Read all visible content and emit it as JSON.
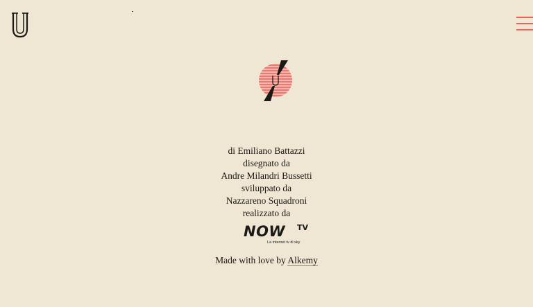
{
  "credits": {
    "line1": "di Emiliano Battazzi",
    "line2": "disegnato da",
    "line3": "Andre Milandri Bussetti",
    "line4": "sviluppato da",
    "line5": "Nazzareno Squadroni",
    "line6": "realizzato da"
  },
  "sponsor": {
    "brand": "NOW",
    "suffix": "TV",
    "tagline": "La internet tv di sky"
  },
  "footer": {
    "text": "Made with love by",
    "link_label": "Alkemy"
  },
  "colors": {
    "background": "#efe6d4",
    "accent": "#e8645a",
    "text": "#1c1a17"
  }
}
